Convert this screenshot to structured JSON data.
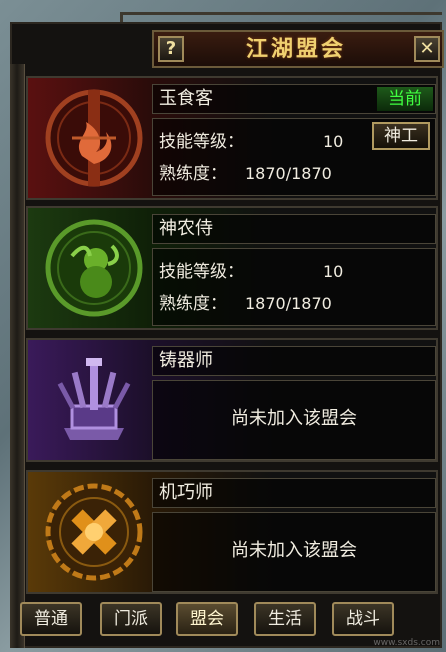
{
  "window": {
    "title": "江湖盟会",
    "help_icon": "?",
    "close_icon": "✕"
  },
  "panels": [
    {
      "name": "玉食客",
      "status": "当前",
      "skill_label": "技能等级：",
      "skill_value": "10",
      "prof_label": "熟练度：",
      "prof_value": "1870/1870",
      "action": "神工",
      "accent": "#c0401a"
    },
    {
      "name": "神农侍",
      "skill_label": "技能等级：",
      "skill_value": "10",
      "prof_label": "熟练度：",
      "prof_value": "1870/1870",
      "accent": "#6ab02a"
    },
    {
      "name": "铸器师",
      "message": "尚未加入该盟会",
      "accent": "#9a6ad0"
    },
    {
      "name": "机巧师",
      "message": "尚未加入该盟会",
      "accent": "#e0901a"
    }
  ],
  "tabs": [
    "普通",
    "门派",
    "盟会",
    "生活",
    "战斗"
  ],
  "active_tab": "盟会",
  "watermark": "www.sxds.com"
}
